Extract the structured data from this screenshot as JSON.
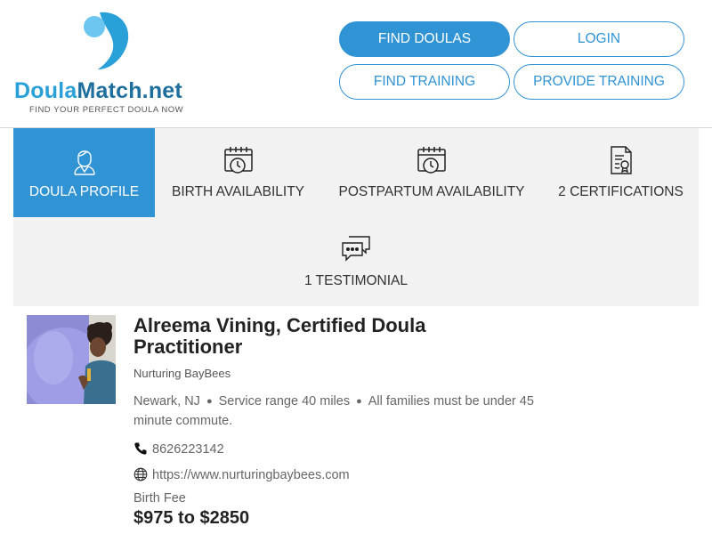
{
  "header": {
    "logo": {
      "name_part1": "Doula",
      "name_part2": "Match.net",
      "tagline": "FIND YOUR PERFECT DOULA NOW",
      "colors": {
        "light_blue": "#6cc6f0",
        "blue": "#2aa0d8",
        "dark_blue": "#1f6f9e"
      }
    },
    "nav": {
      "find_doulas": "FIND DOULAS",
      "login": "LOGIN",
      "find_training": "FIND TRAINING",
      "provide_training": "PROVIDE TRAINING"
    }
  },
  "tabs": [
    {
      "label": "DOULA PROFILE",
      "icon": "doula-person-icon",
      "active": true
    },
    {
      "label": "BIRTH AVAILABILITY",
      "icon": "calendar-clock-icon",
      "active": false
    },
    {
      "label": "POSTPARTUM AVAILABILITY",
      "icon": "calendar-clock-icon",
      "active": false
    },
    {
      "label": "2 CERTIFICATIONS",
      "icon": "certificate-icon",
      "active": false
    },
    {
      "label": "1 TESTIMONIAL",
      "icon": "chat-bubbles-icon",
      "active": false
    }
  ],
  "profile": {
    "name": "Alreema Vining, Certified Doula Practitioner",
    "business": "Nurturing BayBees",
    "location": {
      "city": "Newark, NJ",
      "range": "Service range 40 miles",
      "note": "All families must be under 45 minute commute."
    },
    "phone": "8626223142",
    "website": "https://www.nurturingbaybees.com",
    "fee_label": "Birth Fee",
    "fee_value": "$975 to $2850"
  },
  "colors": {
    "accent": "#2f93d4",
    "tab_background": "#f2f2f2"
  }
}
